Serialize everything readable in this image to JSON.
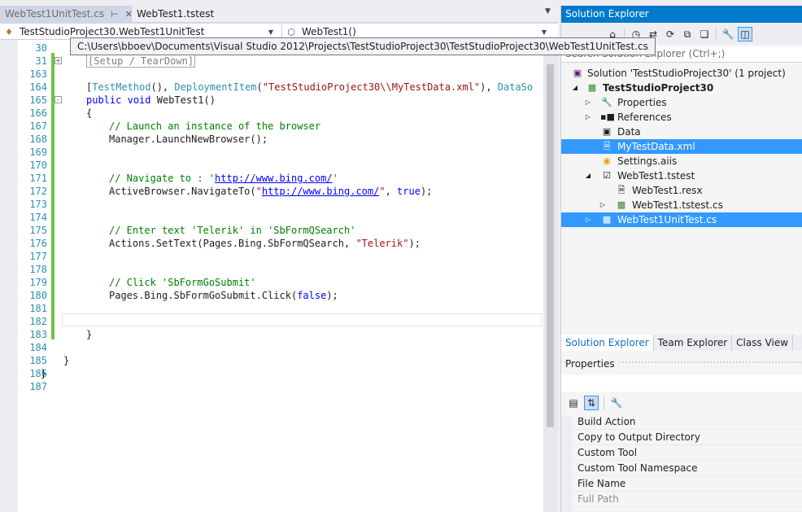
{
  "editor": {
    "tabs": [
      {
        "label": "WebTest1UnitTest.cs",
        "active": false
      },
      {
        "label": "WebTest1.tstest",
        "active": true
      }
    ],
    "nav_left": "TestStudioProject30.WebTest1UnitTest",
    "nav_right": "WebTest1()",
    "tooltip": "C:\\Users\\bboev\\Documents\\Visual Studio 2012\\Projects\\TestStudioProject30\\TestStudioProject30\\WebTest1UnitTest.cs",
    "lines": [
      {
        "num": "30",
        "code": ""
      },
      {
        "num": "31",
        "code": "[Setup / TearDown]"
      },
      {
        "num": "163",
        "code": ""
      },
      {
        "num": "164",
        "code": "[TestMethod(), DeploymentItem(\"TestStudioProject30\\\\MyTestData.xml\"), DataSo"
      },
      {
        "num": "165",
        "code": "public void WebTest1()"
      },
      {
        "num": "166",
        "code": "{"
      },
      {
        "num": "167",
        "code": "// Launch an instance of the browser"
      },
      {
        "num": "168",
        "code": "Manager.LaunchNewBrowser();"
      },
      {
        "num": "169",
        "code": ""
      },
      {
        "num": "170",
        "code": ""
      },
      {
        "num": "171",
        "code": "// Navigate to : 'http://www.bing.com/'"
      },
      {
        "num": "172",
        "code": "ActiveBrowser.NavigateTo(\"http://www.bing.com/\", true);"
      },
      {
        "num": "173",
        "code": ""
      },
      {
        "num": "174",
        "code": ""
      },
      {
        "num": "175",
        "code": "// Enter text 'Telerik' in 'SbFormQSearch'"
      },
      {
        "num": "176",
        "code": "Actions.SetText(Pages.Bing.SbFormQSearch, \"Telerik\");"
      },
      {
        "num": "177",
        "code": ""
      },
      {
        "num": "178",
        "code": ""
      },
      {
        "num": "179",
        "code": "// Click 'SbFormGoSubmit'"
      },
      {
        "num": "180",
        "code": "Pages.Bing.SbFormGoSubmit.Click(false);"
      },
      {
        "num": "181",
        "code": ""
      },
      {
        "num": "182",
        "code": ""
      },
      {
        "num": "183",
        "code": "}"
      },
      {
        "num": "184",
        "code": ""
      },
      {
        "num": "185",
        "code": "}"
      },
      {
        "num": "186",
        "code": "}"
      },
      {
        "num": "187",
        "code": ""
      }
    ]
  },
  "solution_explorer": {
    "title": "Solution Explorer",
    "search_placeholder": "Search Solution Explorer (Ctrl+;)",
    "tree": [
      {
        "label": "Solution 'TestStudioProject30' (1 project)",
        "icon": "solution-icon"
      },
      {
        "label": "TestStudioProject30",
        "icon": "project-icon"
      },
      {
        "label": "Properties",
        "icon": "wrench-icon"
      },
      {
        "label": "References",
        "icon": "references-icon"
      },
      {
        "label": "Data",
        "icon": "folder-icon"
      },
      {
        "label": "MyTestData.xml",
        "icon": "xml-file-icon"
      },
      {
        "label": "Settings.aiis",
        "icon": "settings-file-icon"
      },
      {
        "label": "WebTest1.tstest",
        "icon": "test-file-icon"
      },
      {
        "label": "WebTest1.resx",
        "icon": "resx-file-icon"
      },
      {
        "label": "WebTest1.tstest.cs",
        "icon": "cs-file-icon"
      },
      {
        "label": "WebTest1UnitTest.cs",
        "icon": "cs-file-icon"
      }
    ],
    "bottom_tabs": [
      "Solution Explorer",
      "Team Explorer",
      "Class View"
    ]
  },
  "properties": {
    "title": "Properties",
    "rows": [
      "Build Action",
      "Copy to Output Directory",
      "Custom Tool",
      "Custom Tool Namespace",
      "File Name",
      "Full Path"
    ]
  },
  "colors": {
    "accent": "#007acc",
    "selection": "#3399ff",
    "keyword": "#0000ff",
    "type": "#2b91af",
    "string": "#a31515",
    "comment": "#008000",
    "change_bar": "#6cc644"
  }
}
